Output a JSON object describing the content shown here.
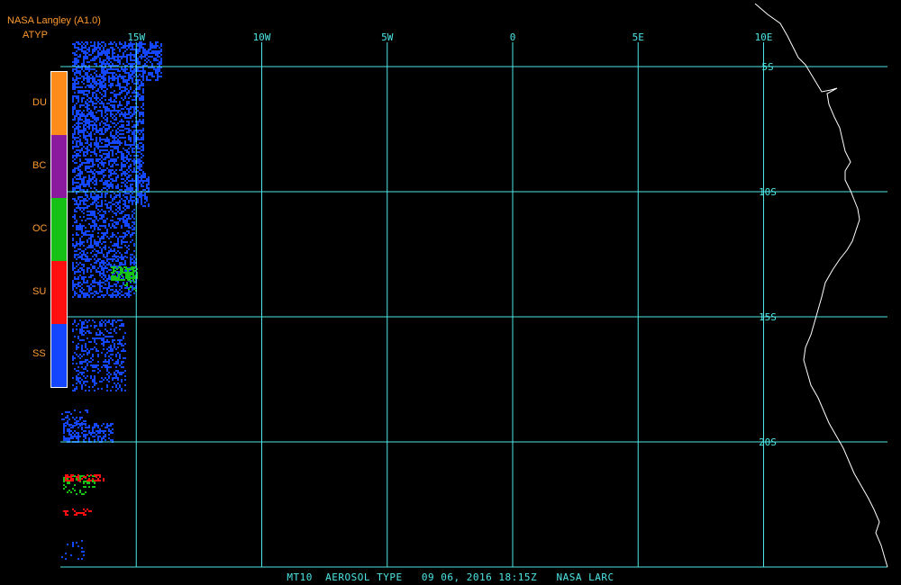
{
  "header": {
    "title": "NASA Langley (A1.0)",
    "product": "ATYP"
  },
  "legend": [
    {
      "code": "DU",
      "color": "#ff8c1a"
    },
    {
      "code": "BC",
      "color": "#8b1a9e"
    },
    {
      "code": "OC",
      "color": "#17c217"
    },
    {
      "code": "SU",
      "color": "#ff1010"
    },
    {
      "code": "SS",
      "color": "#1546ff"
    }
  ],
  "grid": {
    "color": "#4ee6e6",
    "longitudes": [
      {
        "value": -15,
        "label": "15W"
      },
      {
        "value": -10,
        "label": "10W"
      },
      {
        "value": -5,
        "label": "5W"
      },
      {
        "value": 0,
        "label": "0"
      },
      {
        "value": 5,
        "label": "5E"
      },
      {
        "value": 10,
        "label": "10E"
      }
    ],
    "latitudes": [
      {
        "value": -5,
        "label": "5S"
      },
      {
        "value": -10,
        "label": "10S"
      },
      {
        "value": -15,
        "label": "15S"
      },
      {
        "value": -20,
        "label": "20S"
      }
    ]
  },
  "footer": "MT10  AEROSOL TYPE   09 06, 2016 18:15Z   NASA LARC",
  "coastline_color": "#ffffff"
}
